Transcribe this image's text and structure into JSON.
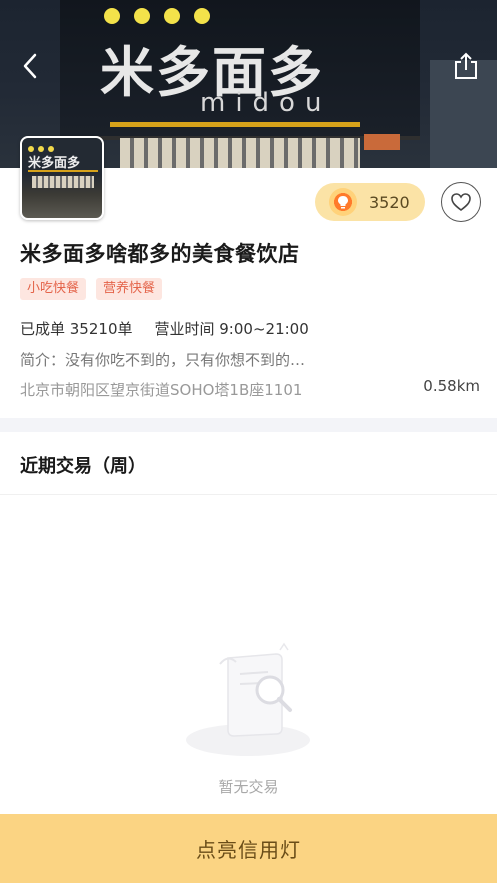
{
  "header": {
    "back_icon": "chevron-left-icon",
    "share_icon": "share-icon",
    "banner_sign": "米多面多",
    "banner_sub": "midou"
  },
  "shop": {
    "thumbnail_sign": "米多面多",
    "score": "3520",
    "score_icon": "lightbulb-icon",
    "favorite_icon": "heart-outline-icon",
    "name": "米多面多啥都多的美食餐饮店",
    "tags": [
      "小吃快餐",
      "营养快餐"
    ],
    "orders": "已成单 35210单",
    "hours": "营业时间 9:00~21:00",
    "intro": "简介：没有你吃不到的，只有你想不到的…",
    "address": "北京市朝阳区望京街道SOHO塔1B座1101",
    "distance": "0.58km"
  },
  "section": {
    "title": "近期交易（周）",
    "empty_text": "暂无交易",
    "empty_icon": "empty-receipt-search-icon"
  },
  "cta": {
    "label": "点亮信用灯"
  },
  "colors": {
    "cta_bg": "#fbd483",
    "tag_text": "#e4644a",
    "tag_bg": "#fde6e0",
    "score_bg": "#fbe3a6"
  }
}
